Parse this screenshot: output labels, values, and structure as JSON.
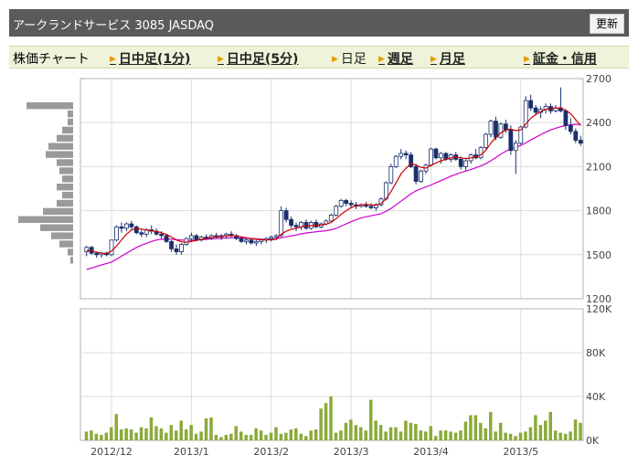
{
  "header": {
    "title": "アークランドサービス 3085 JASDAQ",
    "refresh_label": "更新"
  },
  "nav": {
    "label": "株価チャート",
    "items": [
      {
        "label": "日中足(1分)",
        "link": true
      },
      {
        "label": "日中足(5分)",
        "link": true
      },
      {
        "label": "日足",
        "link": false
      },
      {
        "label": "週足",
        "link": true
      },
      {
        "label": "月足",
        "link": true
      },
      {
        "label": "証金・信用",
        "link": true
      }
    ]
  },
  "colors": {
    "up_candle": "#ffffff",
    "down_candle": "#1a2f6b",
    "short_ma": "#cc0000",
    "long_ma": "#cc00cc",
    "volume": "#8aaa3a",
    "volume_profile": "#9a9a9a",
    "title_bg": "#5a5a5a",
    "nav_bg": "#eef3d9"
  },
  "chart_data": [
    {
      "type": "candlestick",
      "title": "",
      "ylim": [
        1200,
        2700
      ],
      "yticks": [
        1200,
        1500,
        1800,
        2100,
        2400,
        2700
      ],
      "xticks": [
        "2012/12",
        "2013/1",
        "2013/2",
        "2013/3",
        "2013/4",
        "2013/5"
      ],
      "trading_days": 100,
      "tick_positions": [
        5,
        21,
        37,
        53,
        69,
        87
      ],
      "ohlc": [
        [
          1520,
          1560,
          1490,
          1550
        ],
        [
          1550,
          1560,
          1500,
          1510
        ],
        [
          1510,
          1520,
          1480,
          1500
        ],
        [
          1500,
          1520,
          1480,
          1510
        ],
        [
          1510,
          1520,
          1490,
          1500
        ],
        [
          1500,
          1600,
          1490,
          1600
        ],
        [
          1600,
          1700,
          1590,
          1690
        ],
        [
          1690,
          1720,
          1650,
          1680
        ],
        [
          1680,
          1720,
          1660,
          1710
        ],
        [
          1710,
          1730,
          1670,
          1690
        ],
        [
          1690,
          1700,
          1640,
          1650
        ],
        [
          1650,
          1670,
          1620,
          1640
        ],
        [
          1640,
          1680,
          1620,
          1670
        ],
        [
          1670,
          1700,
          1640,
          1660
        ],
        [
          1660,
          1680,
          1630,
          1640
        ],
        [
          1640,
          1660,
          1610,
          1630
        ],
        [
          1630,
          1640,
          1580,
          1590
        ],
        [
          1590,
          1600,
          1520,
          1540
        ],
        [
          1540,
          1570,
          1500,
          1520
        ],
        [
          1520,
          1580,
          1500,
          1570
        ],
        [
          1570,
          1620,
          1560,
          1610
        ],
        [
          1610,
          1650,
          1590,
          1630
        ],
        [
          1630,
          1640,
          1590,
          1600
        ],
        [
          1600,
          1630,
          1590,
          1620
        ],
        [
          1620,
          1640,
          1600,
          1610
        ],
        [
          1610,
          1640,
          1600,
          1630
        ],
        [
          1630,
          1650,
          1610,
          1620
        ],
        [
          1620,
          1640,
          1600,
          1630
        ],
        [
          1630,
          1650,
          1610,
          1640
        ],
        [
          1640,
          1660,
          1620,
          1630
        ],
        [
          1630,
          1640,
          1600,
          1610
        ],
        [
          1610,
          1620,
          1580,
          1590
        ],
        [
          1590,
          1610,
          1570,
          1600
        ],
        [
          1600,
          1610,
          1570,
          1580
        ],
        [
          1580,
          1600,
          1560,
          1590
        ],
        [
          1590,
          1610,
          1570,
          1600
        ],
        [
          1600,
          1620,
          1580,
          1610
        ],
        [
          1610,
          1630,
          1590,
          1620
        ],
        [
          1620,
          1640,
          1600,
          1630
        ],
        [
          1630,
          1830,
          1620,
          1800
        ],
        [
          1800,
          1820,
          1720,
          1740
        ],
        [
          1740,
          1760,
          1680,
          1700
        ],
        [
          1700,
          1720,
          1660,
          1690
        ],
        [
          1690,
          1730,
          1670,
          1720
        ],
        [
          1720,
          1740,
          1670,
          1680
        ],
        [
          1680,
          1730,
          1670,
          1720
        ],
        [
          1720,
          1740,
          1680,
          1690
        ],
        [
          1690,
          1720,
          1680,
          1710
        ],
        [
          1710,
          1740,
          1700,
          1730
        ],
        [
          1730,
          1780,
          1720,
          1770
        ],
        [
          1770,
          1840,
          1760,
          1830
        ],
        [
          1830,
          1880,
          1820,
          1870
        ],
        [
          1870,
          1880,
          1830,
          1850
        ],
        [
          1850,
          1870,
          1820,
          1840
        ],
        [
          1840,
          1860,
          1810,
          1830
        ],
        [
          1830,
          1850,
          1820,
          1840
        ],
        [
          1840,
          1860,
          1820,
          1830
        ],
        [
          1830,
          1850,
          1810,
          1820
        ],
        [
          1820,
          1850,
          1800,
          1840
        ],
        [
          1840,
          1890,
          1830,
          1880
        ],
        [
          1880,
          2000,
          1870,
          1990
        ],
        [
          1990,
          2120,
          1980,
          2100
        ],
        [
          2100,
          2180,
          2090,
          2170
        ],
        [
          2170,
          2220,
          2150,
          2190
        ],
        [
          2190,
          2210,
          2150,
          2180
        ],
        [
          2180,
          2200,
          2090,
          2100
        ],
        [
          2100,
          2120,
          1980,
          2000
        ],
        [
          2000,
          2080,
          1990,
          2070
        ],
        [
          2070,
          2120,
          2050,
          2110
        ],
        [
          2110,
          2230,
          2100,
          2220
        ],
        [
          2220,
          2230,
          2150,
          2160
        ],
        [
          2160,
          2200,
          2120,
          2190
        ],
        [
          2190,
          2200,
          2140,
          2150
        ],
        [
          2150,
          2190,
          2130,
          2180
        ],
        [
          2180,
          2200,
          2140,
          2150
        ],
        [
          2150,
          2170,
          2080,
          2100
        ],
        [
          2100,
          2150,
          2070,
          2140
        ],
        [
          2140,
          2190,
          2120,
          2180
        ],
        [
          2180,
          2220,
          2150,
          2160
        ],
        [
          2160,
          2240,
          2150,
          2230
        ],
        [
          2230,
          2330,
          2220,
          2320
        ],
        [
          2320,
          2420,
          2300,
          2410
        ],
        [
          2410,
          2440,
          2280,
          2300
        ],
        [
          2300,
          2400,
          2290,
          2390
        ],
        [
          2390,
          2420,
          2330,
          2350
        ],
        [
          2350,
          2380,
          2180,
          2210
        ],
        [
          2210,
          2280,
          2050,
          2260
        ],
        [
          2260,
          2380,
          2250,
          2370
        ],
        [
          2370,
          2580,
          2360,
          2550
        ],
        [
          2550,
          2590,
          2480,
          2500
        ],
        [
          2500,
          2520,
          2450,
          2470
        ],
        [
          2470,
          2510,
          2430,
          2490
        ],
        [
          2490,
          2530,
          2460,
          2510
        ],
        [
          2510,
          2530,
          2460,
          2480
        ],
        [
          2480,
          2520,
          2470,
          2500
        ],
        [
          2500,
          2640,
          2470,
          2480
        ],
        [
          2480,
          2490,
          2350,
          2380
        ],
        [
          2380,
          2430,
          2320,
          2340
        ],
        [
          2340,
          2360,
          2260,
          2280
        ],
        [
          2280,
          2310,
          2240,
          2260
        ]
      ],
      "short_ma": [
        1530,
        1525,
        1518,
        1510,
        1508,
        1525,
        1560,
        1600,
        1640,
        1668,
        1680,
        1675,
        1668,
        1664,
        1658,
        1650,
        1638,
        1620,
        1600,
        1588,
        1585,
        1590,
        1598,
        1605,
        1612,
        1618,
        1622,
        1625,
        1628,
        1630,
        1628,
        1622,
        1616,
        1610,
        1605,
        1602,
        1600,
        1602,
        1606,
        1640,
        1660,
        1672,
        1680,
        1690,
        1695,
        1698,
        1700,
        1702,
        1708,
        1720,
        1745,
        1775,
        1800,
        1820,
        1835,
        1840,
        1842,
        1840,
        1838,
        1848,
        1880,
        1930,
        1990,
        2050,
        2090,
        2120,
        2110,
        2095,
        2090,
        2110,
        2125,
        2140,
        2150,
        2160,
        2165,
        2160,
        2155,
        2160,
        2165,
        2180,
        2210,
        2260,
        2300,
        2330,
        2350,
        2355,
        2345,
        2350,
        2390,
        2430,
        2455,
        2475,
        2490,
        2495,
        2500,
        2500,
        2485,
        2460,
        2420,
        2380
      ],
      "long_ma": [
        1400,
        1410,
        1420,
        1430,
        1440,
        1450,
        1470,
        1490,
        1510,
        1530,
        1550,
        1565,
        1578,
        1590,
        1600,
        1605,
        1608,
        1606,
        1602,
        1600,
        1598,
        1598,
        1600,
        1602,
        1605,
        1608,
        1610,
        1612,
        1614,
        1615,
        1615,
        1614,
        1612,
        1610,
        1608,
        1606,
        1605,
        1606,
        1608,
        1615,
        1622,
        1628,
        1635,
        1642,
        1648,
        1652,
        1656,
        1660,
        1664,
        1670,
        1680,
        1695,
        1710,
        1725,
        1738,
        1750,
        1758,
        1765,
        1772,
        1780,
        1795,
        1815,
        1840,
        1865,
        1890,
        1915,
        1935,
        1950,
        1962,
        1975,
        1990,
        2005,
        2020,
        2035,
        2048,
        2060,
        2070,
        2080,
        2092,
        2105,
        2120,
        2140,
        2162,
        2185,
        2205,
        2220,
        2232,
        2245,
        2262,
        2282,
        2300,
        2318,
        2335,
        2350,
        2362,
        2372,
        2380,
        2385,
        2388,
        2388
      ]
    },
    {
      "type": "bar",
      "title": "",
      "ylim": [
        0,
        120000
      ],
      "yticks": [
        "0K",
        "40K",
        "80K",
        "120K"
      ],
      "ytick_values": [
        0,
        40000,
        80000,
        120000
      ],
      "values": [
        8000,
        9000,
        6000,
        5000,
        7000,
        12000,
        24000,
        10000,
        11000,
        10000,
        7000,
        12000,
        11000,
        21000,
        13000,
        11000,
        7000,
        14000,
        9000,
        18000,
        10000,
        14000,
        6000,
        8000,
        20000,
        21000,
        5000,
        3000,
        5000,
        6000,
        13000,
        8000,
        5000,
        5000,
        11000,
        9000,
        5000,
        7000,
        12000,
        6000,
        7000,
        10000,
        11000,
        6000,
        4000,
        9000,
        10000,
        29000,
        34000,
        40000,
        7000,
        9000,
        16000,
        19000,
        14000,
        12000,
        9000,
        37000,
        18000,
        14000,
        8000,
        12000,
        12000,
        8000,
        18000,
        16000,
        15000,
        9000,
        8000,
        13000,
        4000,
        9000,
        9000,
        8000,
        7000,
        9000,
        17000,
        23000,
        23000,
        16000,
        11000,
        26000,
        8000,
        16000,
        7000,
        6000,
        4000,
        7000,
        8000,
        12000,
        23000,
        14000,
        18000,
        26000,
        9000,
        7000,
        6000,
        8000,
        19000,
        16000
      ]
    }
  ],
  "volume_profile": [
    0.85,
    0.1,
    0.1,
    0.2,
    0.3,
    0.45,
    0.5,
    0.3,
    0.25,
    0.2,
    0.3,
    0.2,
    0.3,
    0.55,
    1.0,
    0.6,
    0.4,
    0.25,
    0.1,
    0.05
  ]
}
